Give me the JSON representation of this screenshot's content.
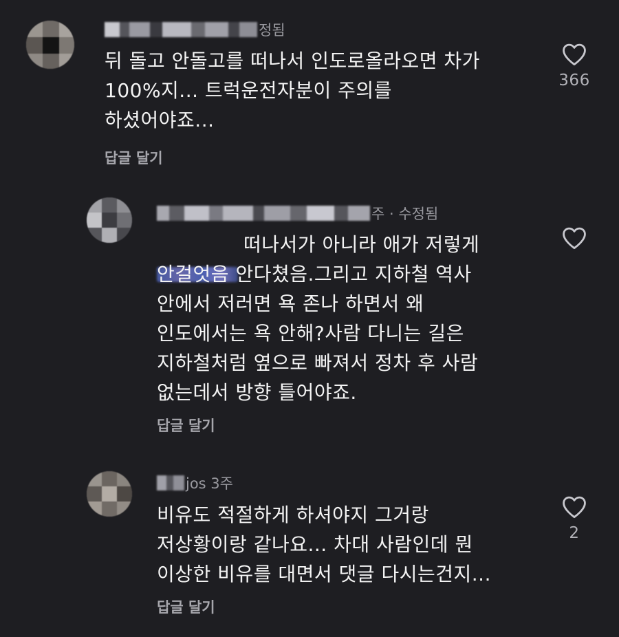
{
  "comments": [
    {
      "meta_suffix": "정됨",
      "text": "뒤 돌고 안돌고를 떠나서 인도로올라오면 차가\n100%지... 트럭운전자분이 주의를\n하셨어야죠...",
      "reply_label": "답글 달기",
      "likes": "366",
      "icon": "heart-outline-icon"
    },
    {
      "meta_suffix": "주 · 수정됨",
      "text": "떠나서가 아니라 애가 저렇게\n안걸엇음 안다쳤음.그리고 지하철 역사\n안에서 저러면 욕 존나 하면서 왜\n인도에서는 욕 안해?사람 다니는 길은\n지하철처럼 옆으로 빠져서 정차 후 사람\n없는데서 방향 틀어야죠.",
      "reply_label": "답글 달기",
      "likes": "",
      "icon": "heart-outline-icon"
    },
    {
      "meta_suffix": "jos 3주",
      "text": "비유도 적절하게 하셔야지 그거랑\n저상황이랑 같나요... 차대 사람인데 뭔\n이상한 비유를 대면서 댓글 다시는건지...",
      "reply_label": "답글 달기",
      "likes": "2",
      "icon": "heart-outline-icon"
    }
  ],
  "colors": {
    "background": "#1e1e22",
    "text": "#f4f4f4",
    "secondary": "#a7a7ad",
    "mention": "#5a6cc0"
  }
}
